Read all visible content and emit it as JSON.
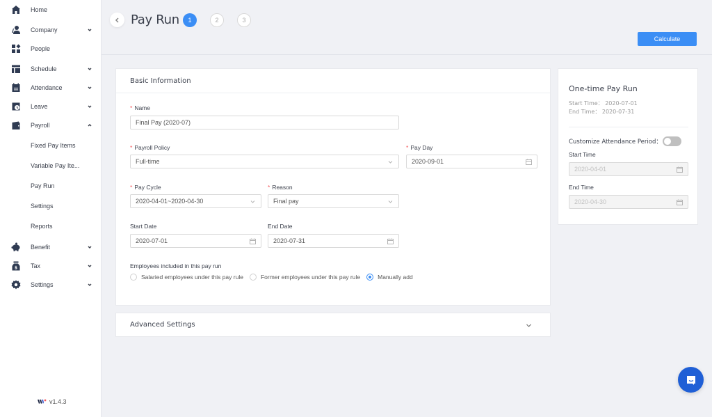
{
  "sidebar": {
    "items": [
      {
        "label": "Home",
        "icon": "home-icon",
        "expandable": false
      },
      {
        "label": "Company",
        "icon": "company-icon",
        "expandable": true,
        "expanded": false
      },
      {
        "label": "People",
        "icon": "people-icon",
        "expandable": false
      },
      {
        "label": "Schedule",
        "icon": "schedule-icon",
        "expandable": true,
        "expanded": false
      },
      {
        "label": "Attendance",
        "icon": "attendance-icon",
        "expandable": true,
        "expanded": false
      },
      {
        "label": "Leave",
        "icon": "leave-icon",
        "expandable": true,
        "expanded": false
      },
      {
        "label": "Payroll",
        "icon": "wallet-icon",
        "expandable": true,
        "expanded": true
      },
      {
        "label": "Benefit",
        "icon": "piggy-bank-icon",
        "expandable": true,
        "expanded": false
      },
      {
        "label": "Tax",
        "icon": "money-bag-icon",
        "expandable": true,
        "expanded": false
      },
      {
        "label": "Settings",
        "icon": "gear-icon",
        "expandable": true,
        "expanded": false
      }
    ],
    "payroll_sub": [
      {
        "label": "Fixed Pay Items"
      },
      {
        "label": "Variable Pay Ite..."
      },
      {
        "label": "Pay Run"
      },
      {
        "label": "Settings"
      },
      {
        "label": "Reports"
      }
    ],
    "version": "v1.4.3"
  },
  "header": {
    "title": "Pay Run",
    "steps": [
      "1",
      "2",
      "3"
    ],
    "active_step": 1,
    "calculate_label": "Calculate"
  },
  "basic": {
    "title": "Basic Information",
    "name_label": "Name",
    "name_value": "Final Pay (2020-07)",
    "policy_label": "Payroll Policy",
    "policy_value": "Full-time",
    "payday_label": "Pay Day",
    "payday_value": "2020-09-01",
    "cycle_label": "Pay Cycle",
    "cycle_value": "2020-04-01~2020-04-30",
    "reason_label": "Reason",
    "reason_value": "Final pay",
    "start_label": "Start Date",
    "start_value": "2020-07-01",
    "end_label": "End Date",
    "end_value": "2020-07-31",
    "employees_label": "Employees included in this pay run",
    "employee_options": [
      {
        "label": "Salaried employees under this pay rule",
        "selected": false
      },
      {
        "label": "Former employees under this pay rule",
        "selected": false
      },
      {
        "label": "Manually add",
        "selected": true
      }
    ]
  },
  "advanced": {
    "title": "Advanced Settings"
  },
  "side": {
    "title": "One-time Pay Run",
    "start_time_text": "Start Time： 2020-07-01",
    "end_time_text": "End Time： 2020-07-31",
    "toggle_label": "Customize Attendance Period：",
    "toggle_on": false,
    "start_label": "Start Time",
    "start_value": "2020-04-01",
    "end_label": "End Time",
    "end_value": "2020-04-30"
  },
  "colors": {
    "accent": "#3b8ef5",
    "required": "#f5565a",
    "chat": "#1f5fd6",
    "icon": "#2f3b52"
  }
}
